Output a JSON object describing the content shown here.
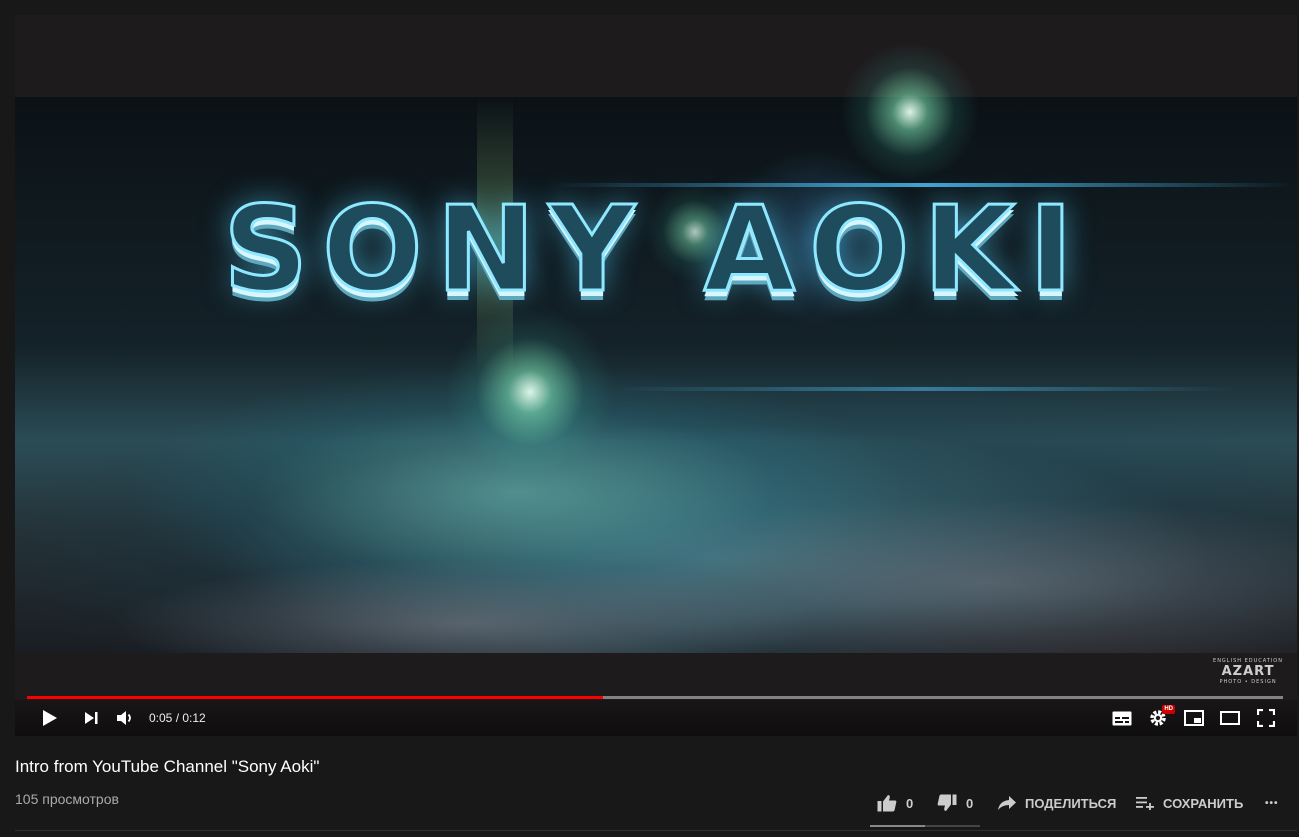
{
  "video": {
    "logo_text": "SONY AOKI",
    "watermark_top": "ENGLISH EDUCATION",
    "watermark_name": "AZART",
    "watermark_sub": "PHOTO • DESIGN"
  },
  "player": {
    "progress_fraction": 0.4583,
    "time_display": "0:05 / 0:12",
    "hd_badge": "HD"
  },
  "info": {
    "title": "Intro from YouTube Channel \"Sony Aoki\"",
    "views": "105 просмотров",
    "likes": "0",
    "dislikes": "0",
    "share_label": "ПОДЕЛИТЬСЯ",
    "save_label": "СОХРАНИТЬ",
    "more_label": "•••"
  },
  "colors": {
    "progress_played": "#ff0000",
    "background": "#181818"
  }
}
